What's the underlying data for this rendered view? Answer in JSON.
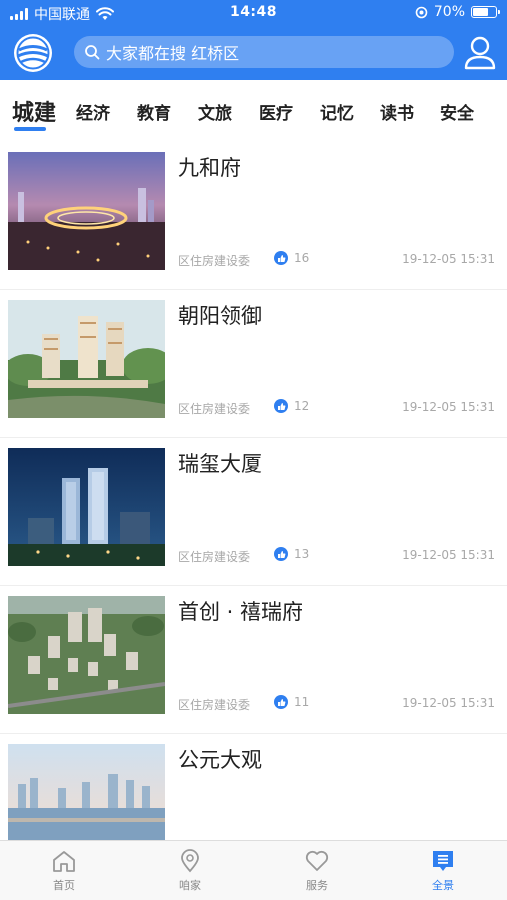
{
  "status_bar": {
    "carrier": "中国联通",
    "time": "14:48",
    "battery": "70%",
    "battery_level": 0.7
  },
  "header": {
    "logo_icon": "app-logo-icon",
    "search_placeholder": "大家都在搜 红桥区",
    "user_icon": "user-icon"
  },
  "tabs": [
    {
      "label": "城建",
      "active": true
    },
    {
      "label": "经济"
    },
    {
      "label": "教育"
    },
    {
      "label": "文旅"
    },
    {
      "label": "医疗"
    },
    {
      "label": "记忆"
    },
    {
      "label": "读书"
    },
    {
      "label": "安全"
    }
  ],
  "articles": [
    {
      "title": "九和府",
      "source": "区住房建设委",
      "likes": "16",
      "date": "19-12-05 15:31"
    },
    {
      "title": "朝阳领御",
      "source": "区住房建设委",
      "likes": "12",
      "date": "19-12-05 15:31"
    },
    {
      "title": "瑞玺大厦",
      "source": "区住房建设委",
      "likes": "13",
      "date": "19-12-05 15:31"
    },
    {
      "title": "首创 · 禧瑞府",
      "source": "区住房建设委",
      "likes": "11",
      "date": "19-12-05 15:31"
    },
    {
      "title": "公元大观",
      "source": "",
      "likes": "",
      "date": ""
    }
  ],
  "tab_bar": [
    {
      "label": "首页",
      "icon": "home-icon"
    },
    {
      "label": "咱家",
      "icon": "location-icon"
    },
    {
      "label": "服务",
      "icon": "heart-icon"
    },
    {
      "label": "全景",
      "icon": "panorama-icon",
      "active": true
    }
  ],
  "colors": {
    "accent": "#2f7ff0"
  }
}
